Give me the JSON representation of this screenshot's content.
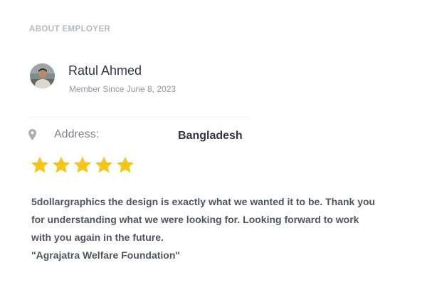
{
  "section": {
    "title": "ABOUT EMPLOYER"
  },
  "employer": {
    "avatar_icon": "user-avatar-photo",
    "name": "Ratul Ahmed",
    "member_since": "Member Since June 8, 2023"
  },
  "address": {
    "icon": "map-pin-icon",
    "label": "Address:",
    "value": "Bangladesh"
  },
  "rating": {
    "stars_filled": 5,
    "stars_total": 5,
    "star_color": "#f5c518"
  },
  "review": {
    "text": "5dollargraphics the design is exactly what we wanted it to be. Thank you for understanding what we were looking for. Looking forward to work with you again in the future.",
    "signature": "\"Agrajatra Welfare Foundation\""
  }
}
